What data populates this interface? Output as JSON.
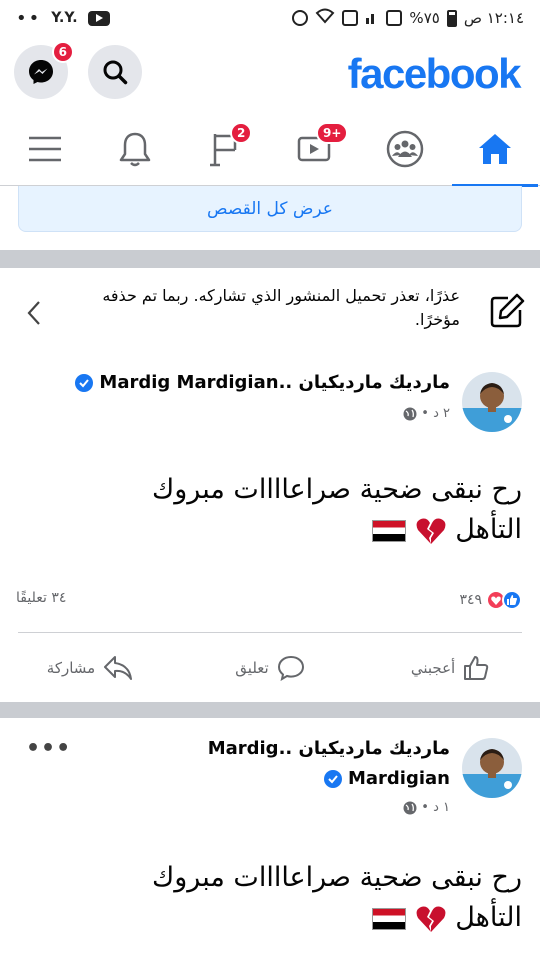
{
  "status_bar": {
    "time": "١٢:١٤ ص",
    "battery": "%٧٥",
    "left_tag": "Y.Y.",
    "left_dots": "••"
  },
  "header": {
    "logo": "facebook",
    "messenger_badge": "6"
  },
  "nav": {
    "items": [
      {
        "name": "home",
        "active": true
      },
      {
        "name": "groups"
      },
      {
        "name": "watch",
        "badge": "9+"
      },
      {
        "name": "pages",
        "badge": "2"
      },
      {
        "name": "notifications"
      },
      {
        "name": "menu"
      }
    ]
  },
  "stories": {
    "see_all_label": "عرض كل القصص"
  },
  "failed_upload": {
    "message": "عذرًا، تعذر تحميل المنشور الذي تشاركه. ربما تم حذفه مؤخرًا."
  },
  "posts": [
    {
      "author": "ماردیك ماردیكیان ..Mardig Mardigian",
      "time": "٢ د •",
      "text_line1": "رح نبقى ضحية صراعاااات  مبروك",
      "text_line2": "التأهل",
      "reactions_count": "٣٤٩",
      "comments_count": "٣٤ تعليقًا",
      "actions": {
        "like": "أعجبني",
        "comment": "تعليق",
        "share": "مشاركة"
      }
    },
    {
      "author_line1": "ماردیك ماردیكیان ..Mardig",
      "author_line2": "Mardigian",
      "time": "١ د •",
      "text_line1": "رح نبقى ضحية صراعاااات  مبروك",
      "text_line2": "التأهل",
      "more": "•••"
    }
  ],
  "colors": {
    "brand": "#1877f2",
    "badge": "#e41e3f",
    "separator": "#c9ccd1"
  }
}
